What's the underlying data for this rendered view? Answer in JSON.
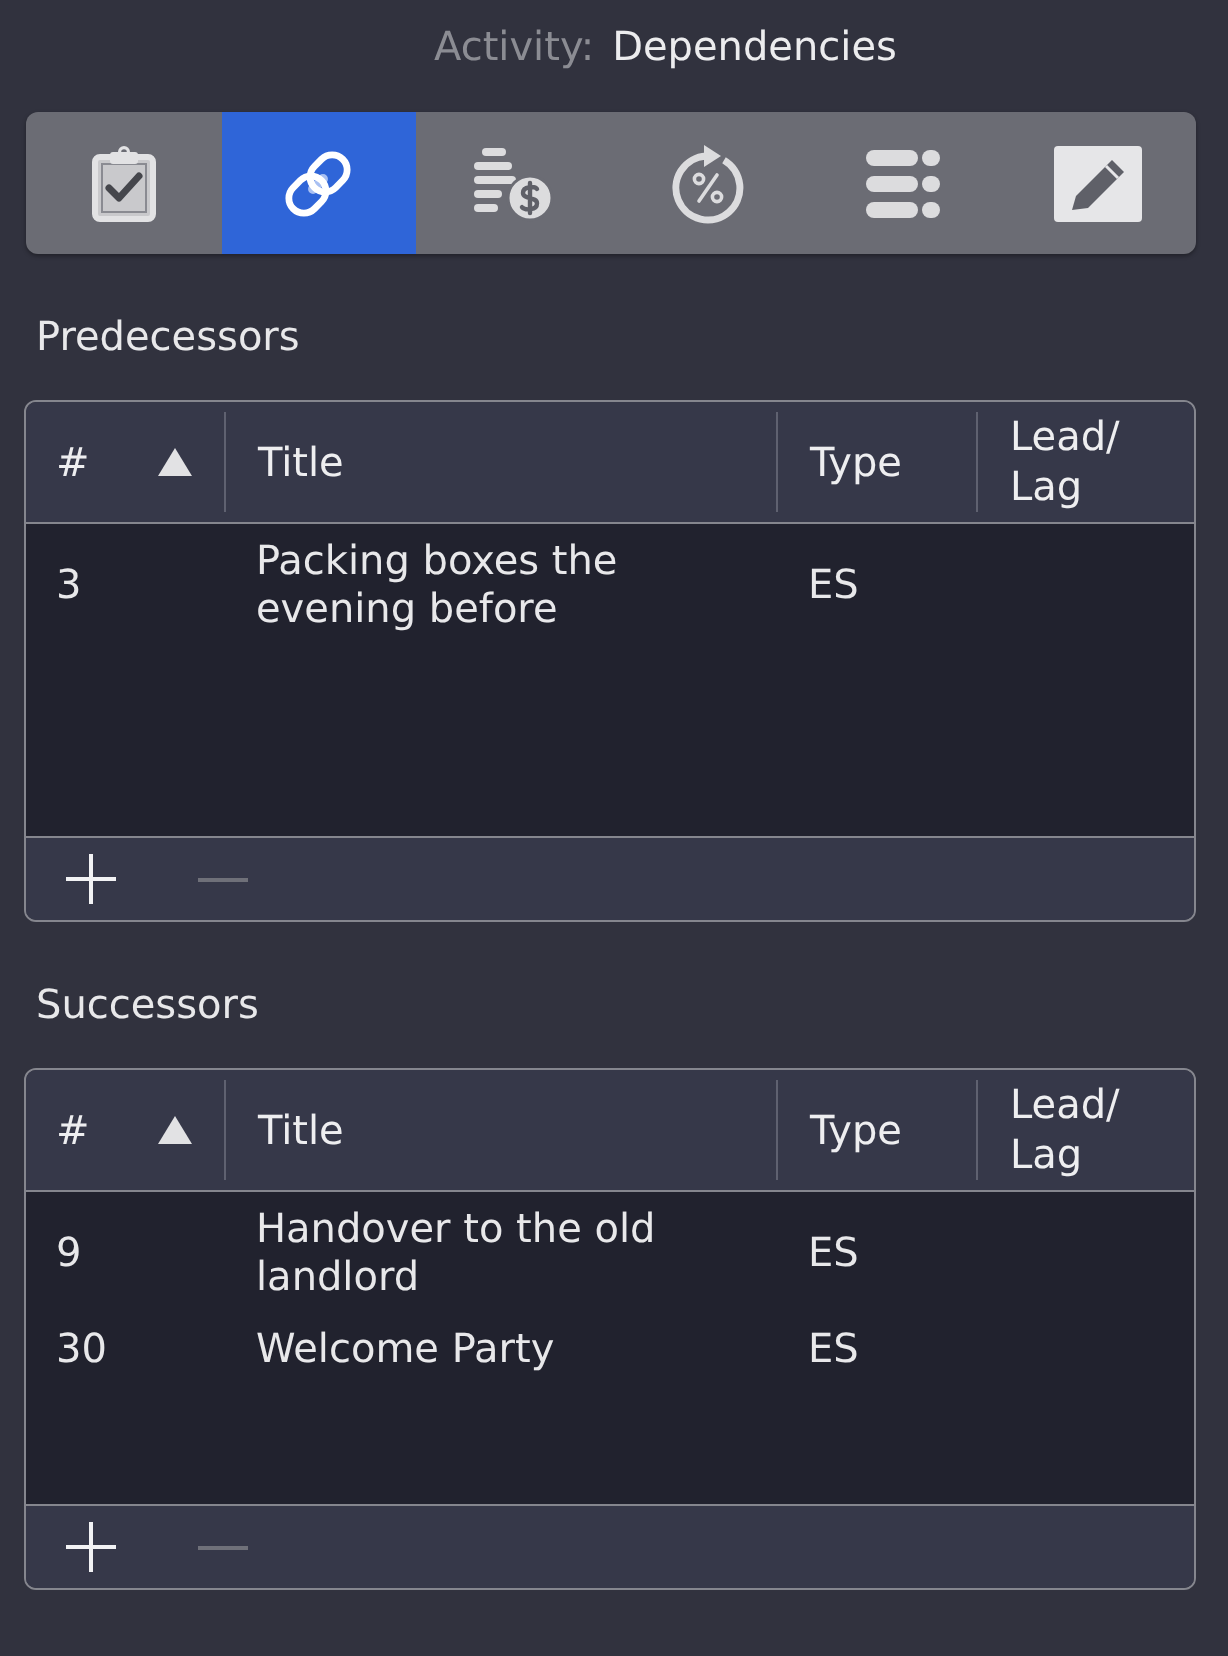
{
  "activity": {
    "label": "Activity:",
    "value": "Dependencies"
  },
  "toolbar": [
    {
      "kind": "checklist",
      "selected": false
    },
    {
      "kind": "link",
      "selected": true
    },
    {
      "kind": "costs",
      "selected": false
    },
    {
      "kind": "progress",
      "selected": false
    },
    {
      "kind": "list",
      "selected": false
    },
    {
      "kind": "notes",
      "selected": false
    }
  ],
  "sections": [
    {
      "title": "Predecessors",
      "columns": [
        {
          "label": "#",
          "sorted": true
        },
        {
          "label": "Title",
          "sorted": false
        },
        {
          "label": "Type",
          "sorted": false
        },
        {
          "label": "Lead/Lag",
          "sorted": false
        }
      ],
      "rows": [
        {
          "cells": [
            "3",
            "Packing boxes the evening before",
            "ES"
          ]
        }
      ],
      "buttons": [
        {
          "kind": "add",
          "disabled": false
        },
        {
          "kind": "remove",
          "disabled": true
        }
      ]
    },
    {
      "title": "Successors",
      "columns": [
        {
          "label": "#",
          "sorted": true
        },
        {
          "label": "Title",
          "sorted": false
        },
        {
          "label": "Type",
          "sorted": false
        },
        {
          "label": "Lead/Lag",
          "sorted": false
        }
      ],
      "rows": [
        {
          "cells": [
            "9",
            "Handover to the old landlord",
            "ES"
          ]
        },
        {
          "cells": [
            "30",
            "Welcome Party",
            "ES"
          ]
        }
      ],
      "buttons": [
        {
          "kind": "add",
          "disabled": false
        },
        {
          "kind": "remove",
          "disabled": true
        }
      ]
    }
  ]
}
